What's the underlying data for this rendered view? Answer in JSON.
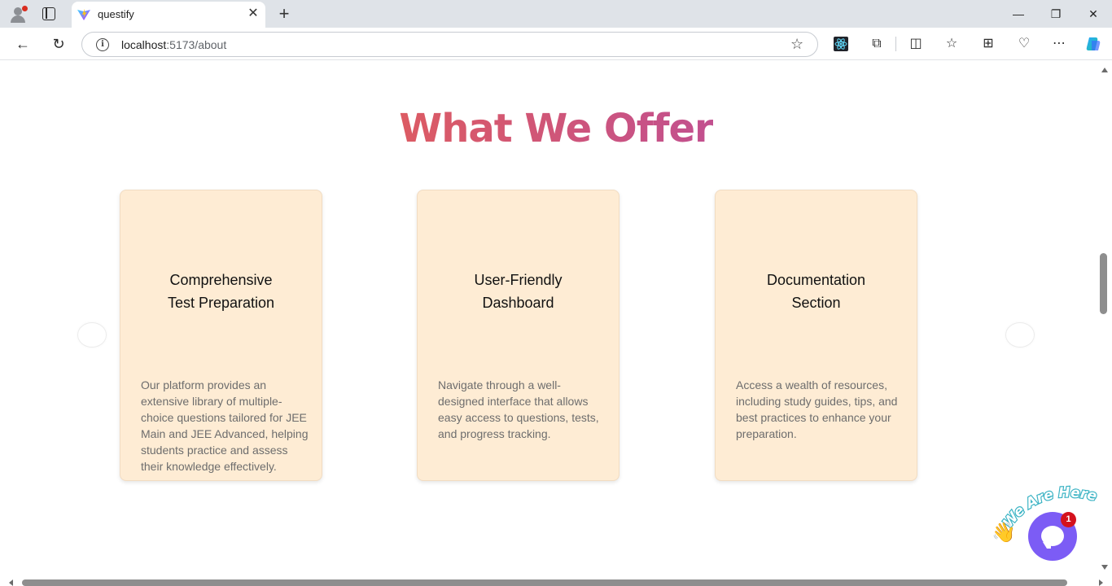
{
  "browser": {
    "tab_title": "questify",
    "tab_close": "✕",
    "new_tab": "+",
    "url_host": "localhost",
    "url_path": ":5173/about",
    "window_controls": {
      "minimize": "—",
      "restore": "❐",
      "close": "✕"
    }
  },
  "toolbar_icons": [
    "back-icon",
    "refresh-icon",
    "star-icon",
    "react-devtools-icon",
    "extensions-icon",
    "split-screen-icon",
    "favorites-icon",
    "collections-icon",
    "browser-essentials-icon",
    "more-icon",
    "copilot-icon"
  ],
  "page": {
    "heading": "What We Offer",
    "accent_gradient": [
      "#dc5b63",
      "#c2508f"
    ],
    "card_color": "#feecd4",
    "cards": [
      {
        "title_line1": "Comprehensive",
        "title_line2": "Test Preparation",
        "description": "Our platform provides an extensive library of multiple-choice questions tailored for JEE Main and JEE Advanced, helping students practice and assess their knowledge effectively."
      },
      {
        "title_line1": "User-Friendly",
        "title_line2": "Dashboard",
        "description": "Navigate through a well-designed interface that allows easy access to questions, tests, and progress tracking."
      },
      {
        "title_line1": "Documentation",
        "title_line2": "Section",
        "description": "Access a wealth of resources, including study guides, tips, and best practices to enhance your preparation."
      }
    ]
  },
  "chat_widget": {
    "tagline": "We Are Here!",
    "badge_count": "1",
    "wave_emoji": "👋",
    "bubble_color": "#7c5cf5"
  }
}
